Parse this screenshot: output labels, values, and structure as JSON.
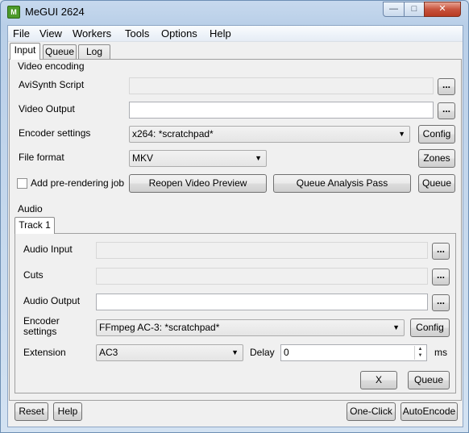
{
  "window": {
    "title": "MeGUI 2624",
    "icon_glyph": "M"
  },
  "menu": [
    "File",
    "View",
    "Workers",
    "Tools",
    "Options",
    "Help"
  ],
  "tabs": [
    "Input",
    "Queue",
    "Log"
  ],
  "video": {
    "group_label": "Video encoding",
    "avisynth_label": "AviSynth Script",
    "avisynth_value": "",
    "output_label": "Video Output",
    "output_value": "",
    "encoder_label": "Encoder settings",
    "encoder_value": "x264: *scratchpad*",
    "config_button": "Config",
    "format_label": "File format",
    "format_value": "MKV",
    "zones_button": "Zones",
    "prerender_label": "Add pre-rendering job",
    "reopen_button": "Reopen Video Preview",
    "analysis_button": "Queue Analysis Pass",
    "queue_button": "Queue",
    "browse": "..."
  },
  "audio": {
    "group_label": "Audio",
    "track_tab": "Track 1",
    "input_label": "Audio Input",
    "cuts_label": "Cuts",
    "output_label": "Audio Output",
    "encoder_label_1": "Encoder",
    "encoder_label_2": "settings",
    "encoder_value": "FFmpeg AC-3: *scratchpad*",
    "config_button": "Config",
    "extension_label": "Extension",
    "extension_value": "AC3",
    "delay_label": "Delay",
    "delay_value": "0",
    "ms_label": "ms",
    "x_button": "X",
    "queue_button": "Queue",
    "browse": "..."
  },
  "bottom": {
    "reset_button": "Reset",
    "help_button": "Help",
    "oneclick_button": "One-Click",
    "autoencode_button": "AutoEncode"
  }
}
